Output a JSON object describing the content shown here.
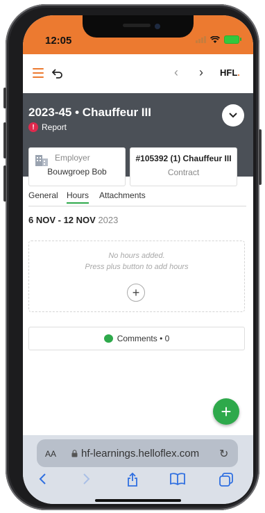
{
  "status": {
    "time": "12:05"
  },
  "topbar": {
    "back_icon": "undo-arrow-icon",
    "prev": "‹",
    "next": "›",
    "logo_text": "HFL",
    "logo_dot": "."
  },
  "header": {
    "title": "2023-45 • Chauffeur III",
    "report_label": "Report",
    "report_icon": "!",
    "expand_icon": "⌄",
    "employer_label": "Employer",
    "employer_value": "Bouwgroep Bob",
    "contract_id": "#105392 (1) Chauffeur III",
    "contract_label": "Contract"
  },
  "tabs": [
    {
      "label": "General",
      "active": false
    },
    {
      "label": "Hours",
      "active": true
    },
    {
      "label": "Attachments",
      "active": false
    }
  ],
  "week": {
    "range": "6 NOV - 12 NOV",
    "year": "2023"
  },
  "empty_state": {
    "line1": "No hours added.",
    "line2": "Press plus button to add hours",
    "add": "+"
  },
  "comments": {
    "label": "Comments • 0"
  },
  "fab": {
    "label": "+"
  },
  "browser": {
    "aa": "AA",
    "url": "hf-learnings.helloflex.com",
    "reload": "↻"
  },
  "colors": {
    "brand": "#ec7a30",
    "accent_green": "#2ea94b",
    "header_bg": "#4b5057",
    "alert_red": "#e0294d"
  }
}
